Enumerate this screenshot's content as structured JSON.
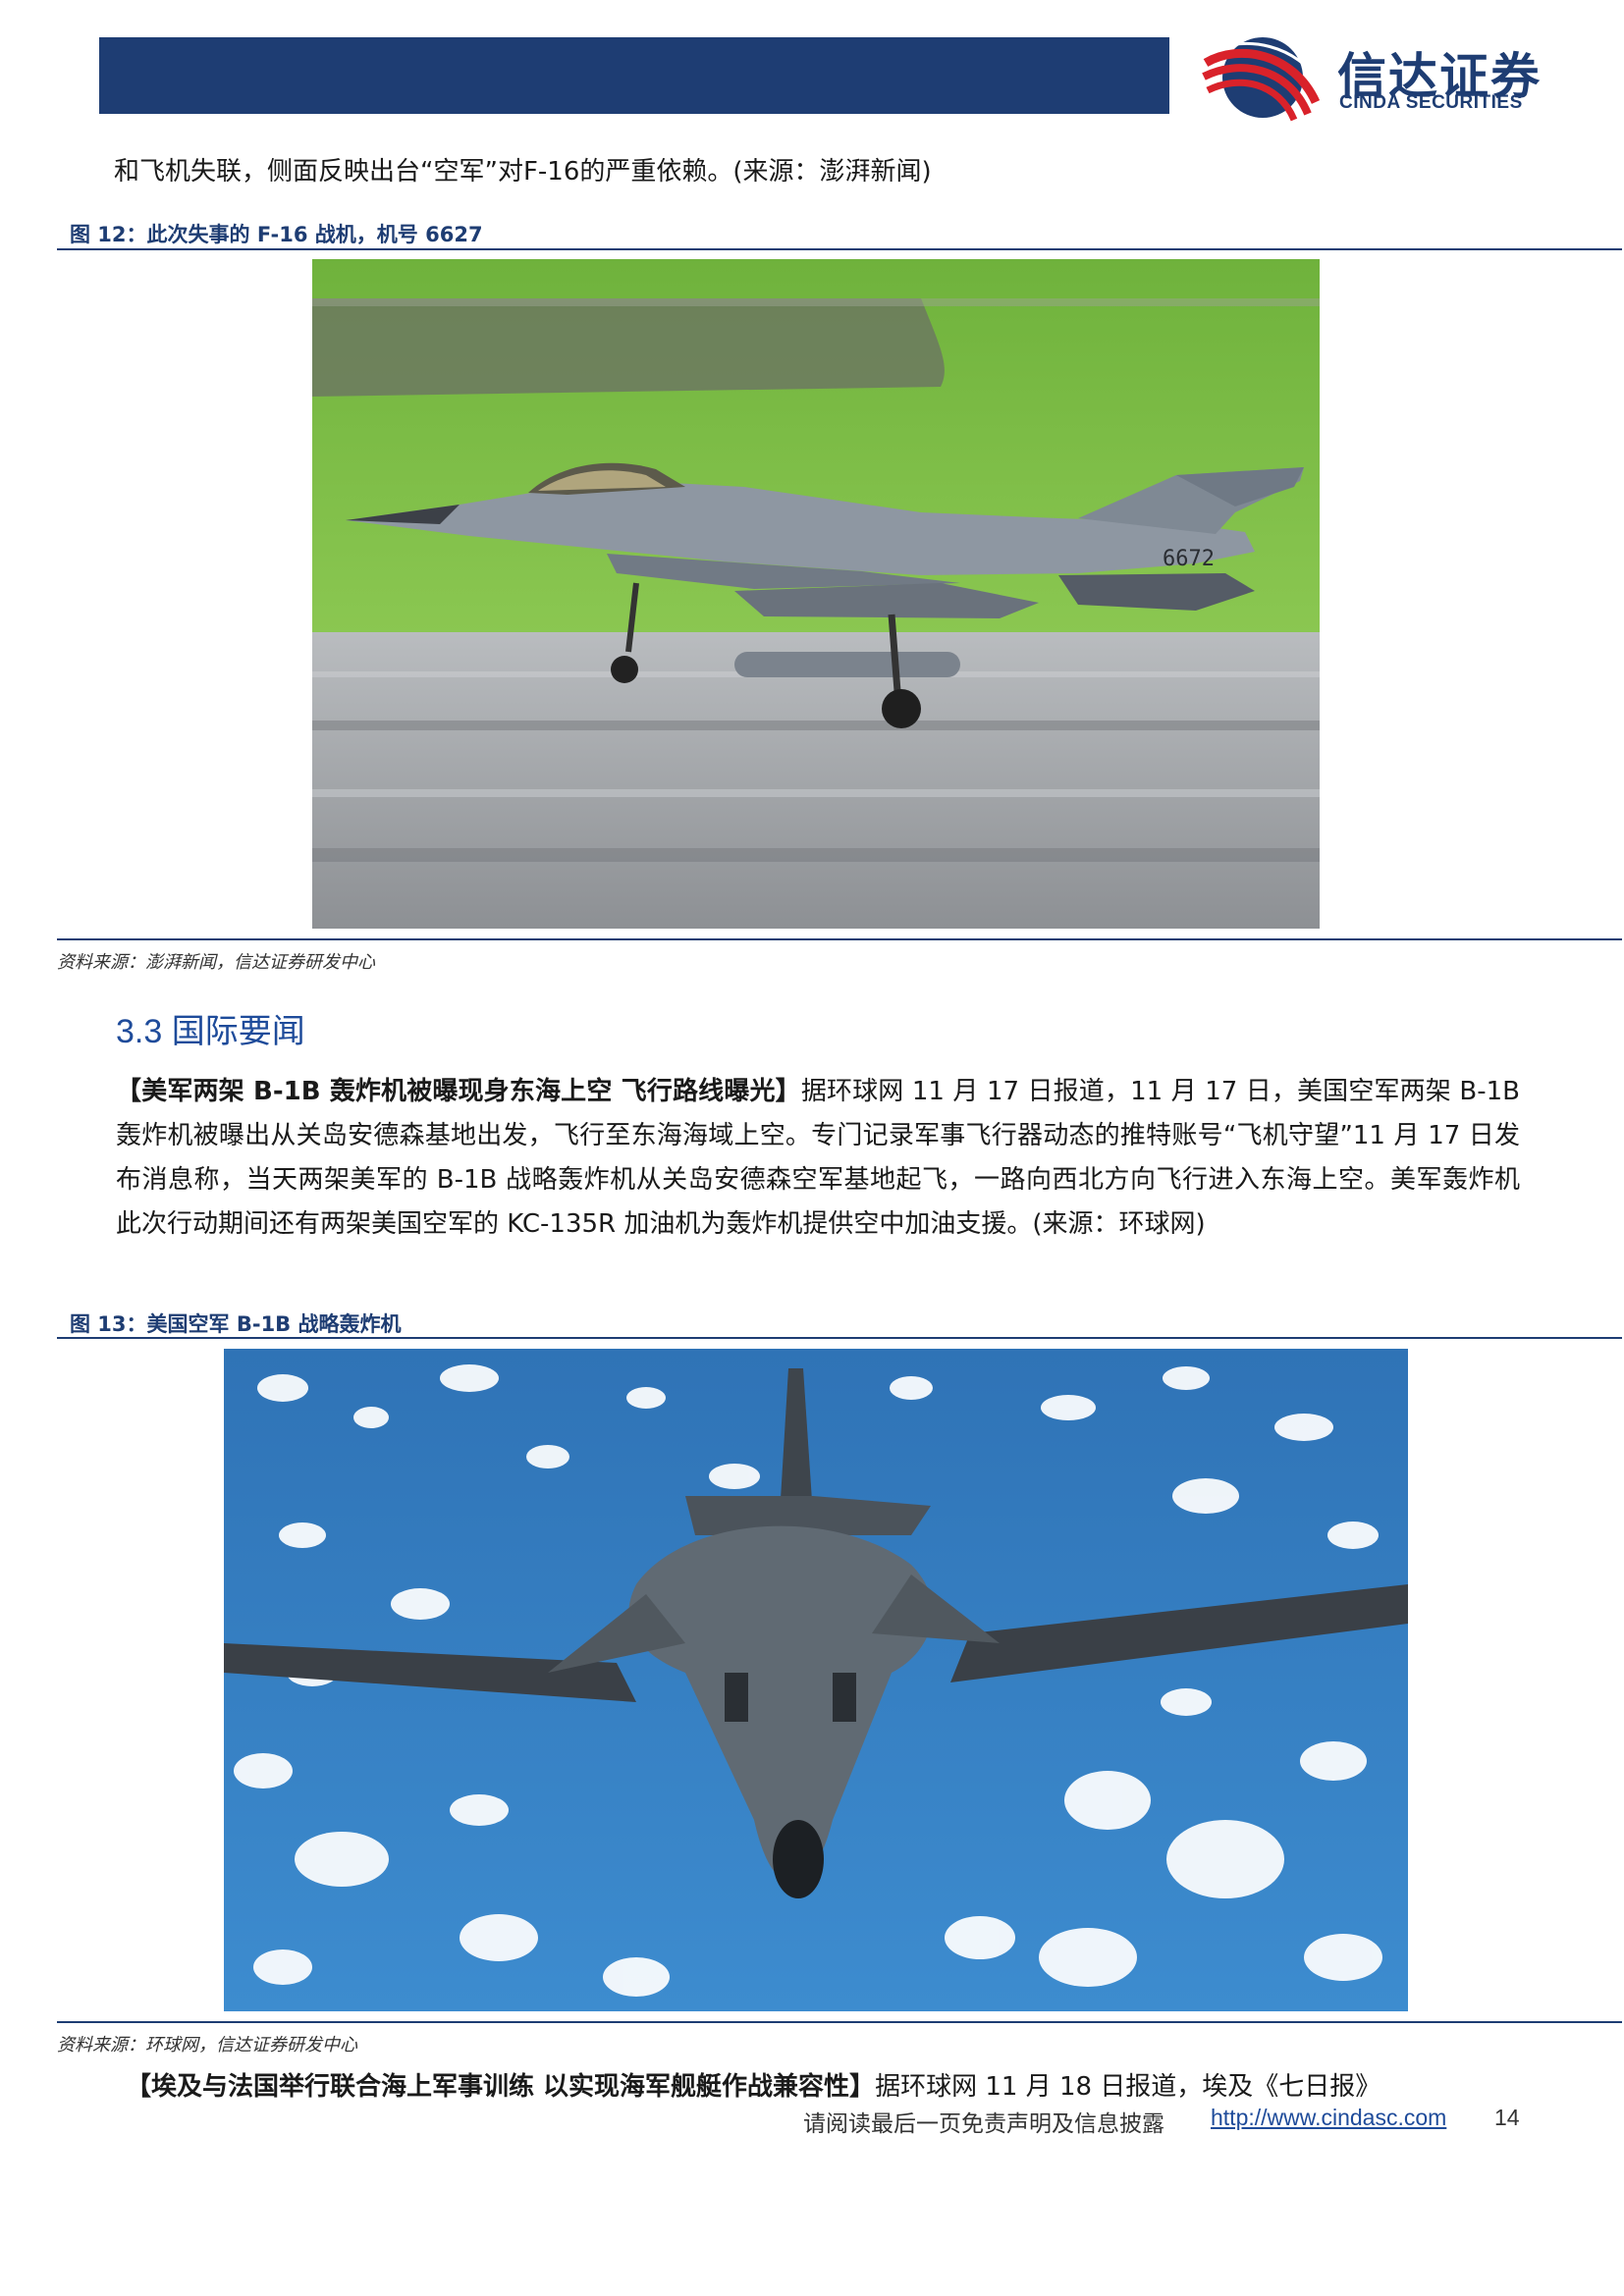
{
  "header": {
    "logo_cn": "信达证券",
    "logo_en": "CINDA SECURITIES",
    "brand_color": "#1e3d73"
  },
  "continuation_text": "和飞机失联，侧面反映出台“空军”对F-16的严重依赖。(来源：澎湃新闻)",
  "figure12": {
    "title": "图 12：此次失事的 F-16 战机，机号 6627",
    "tail_number": "6672",
    "source": "资料来源：澎湃新闻，信达证券研发中心"
  },
  "section": {
    "title": "3.3 国际要闻"
  },
  "news1": {
    "lead": "【美军两架 B-1B 轰炸机被曝现身东海上空  飞行路线曝光】",
    "body": "据环球网 11 月 17 日报道，11 月 17 日，美国空军两架 B-1B 轰炸机被曝出从关岛安德森基地出发，飞行至东海海域上空。专门记录军事飞行器动态的推特账号“飞机守望”11 月 17 日发布消息称，当天两架美军的 B-1B 战略轰炸机从关岛安德森空军基地起飞，一路向西北方向飞行进入东海上空。美军轰炸机此次行动期间还有两架美国空军的 KC-135R 加油机为轰炸机提供空中加油支援。(来源：环球网)"
  },
  "figure13": {
    "title": "图 13：美国空军 B-1B 战略轰炸机",
    "source": "资料来源：环球网，信达证券研发中心"
  },
  "news2": {
    "lead": "【埃及与法国举行联合海上军事训练  以实现海军舰艇作战兼容性】",
    "body": "据环球网 11 月 18 日报道，埃及《七日报》"
  },
  "footer": {
    "disclaimer": "请阅读最后一页免责声明及信息披露",
    "url": "http://www.cindasc.com",
    "page": "14"
  }
}
